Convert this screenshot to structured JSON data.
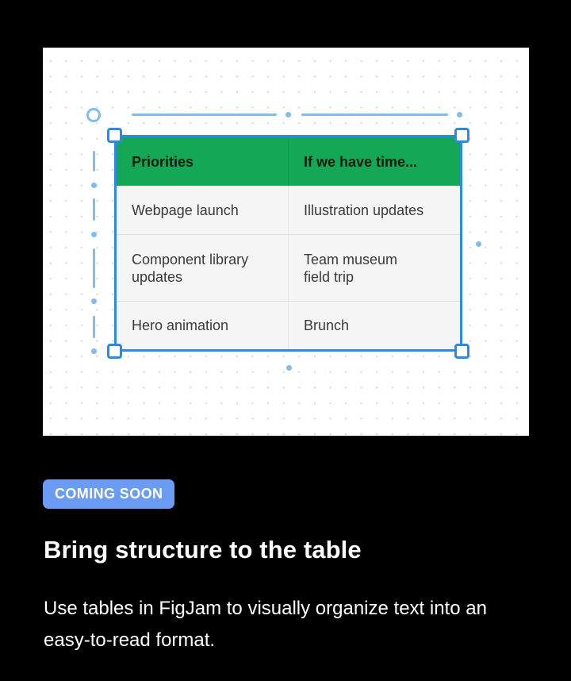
{
  "illustration": {
    "table": {
      "headers": [
        "Priorities",
        "If we have time..."
      ],
      "rows": [
        [
          "Webpage launch",
          "Illustration updates"
        ],
        [
          "Component library updates",
          "Team museum field trip"
        ],
        [
          "Hero animation",
          "Brunch"
        ]
      ],
      "header_color": "#14a755",
      "selection_color": "#2a8ae5"
    }
  },
  "badge": {
    "label": "COMING SOON",
    "color": "#6a9cf5"
  },
  "heading": "Bring structure to the table",
  "description": "Use tables in FigJam to visually organize text into an easy-to-read format."
}
